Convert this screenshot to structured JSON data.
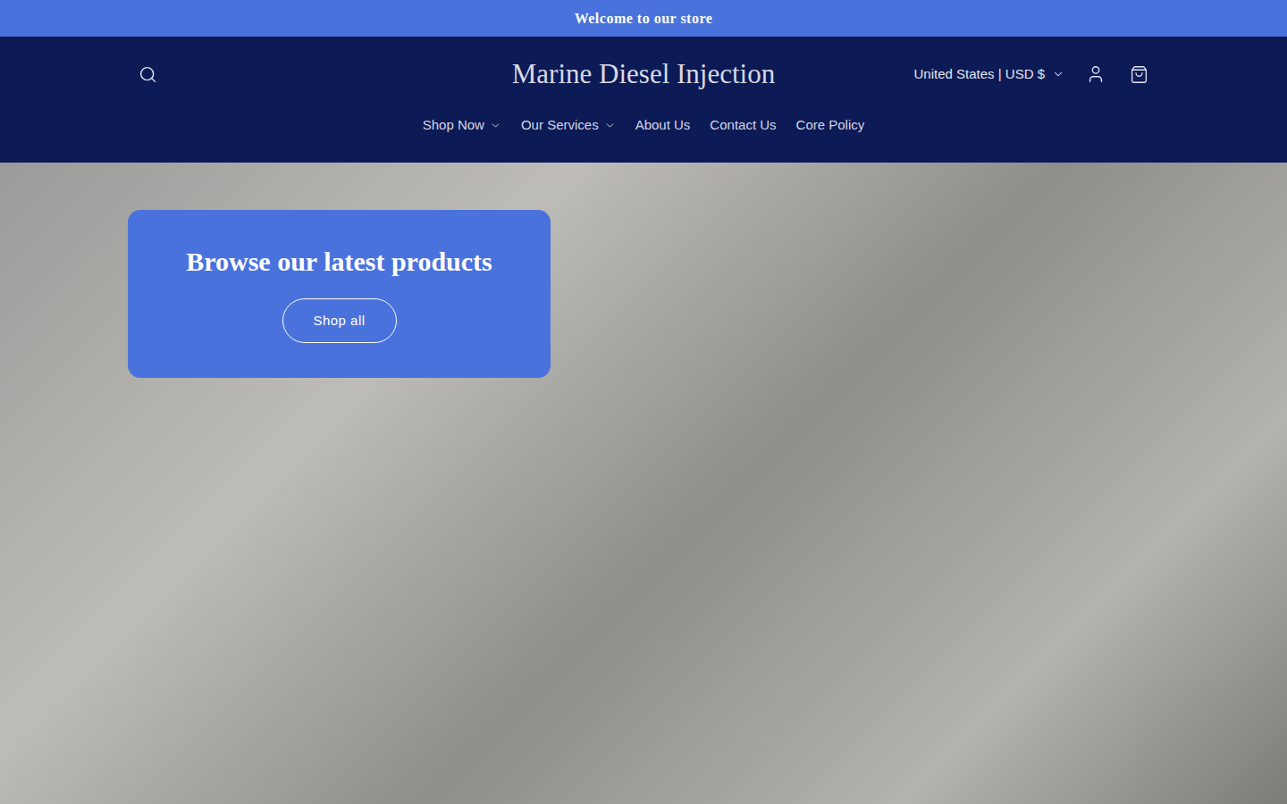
{
  "announcement": {
    "text": "Welcome to our store"
  },
  "header": {
    "logo": "Marine Diesel Injection",
    "country_selector": {
      "label": "United States | USD $",
      "expanded": false
    }
  },
  "nav": {
    "items": [
      {
        "label": "Shop Now",
        "has_dropdown": true
      },
      {
        "label": "Our Services",
        "has_dropdown": true
      },
      {
        "label": "About Us",
        "has_dropdown": false
      },
      {
        "label": "Contact Us",
        "has_dropdown": false
      },
      {
        "label": "Core Policy",
        "has_dropdown": false
      }
    ]
  },
  "hero": {
    "heading": "Browse our latest products",
    "button": "Shop all"
  }
}
